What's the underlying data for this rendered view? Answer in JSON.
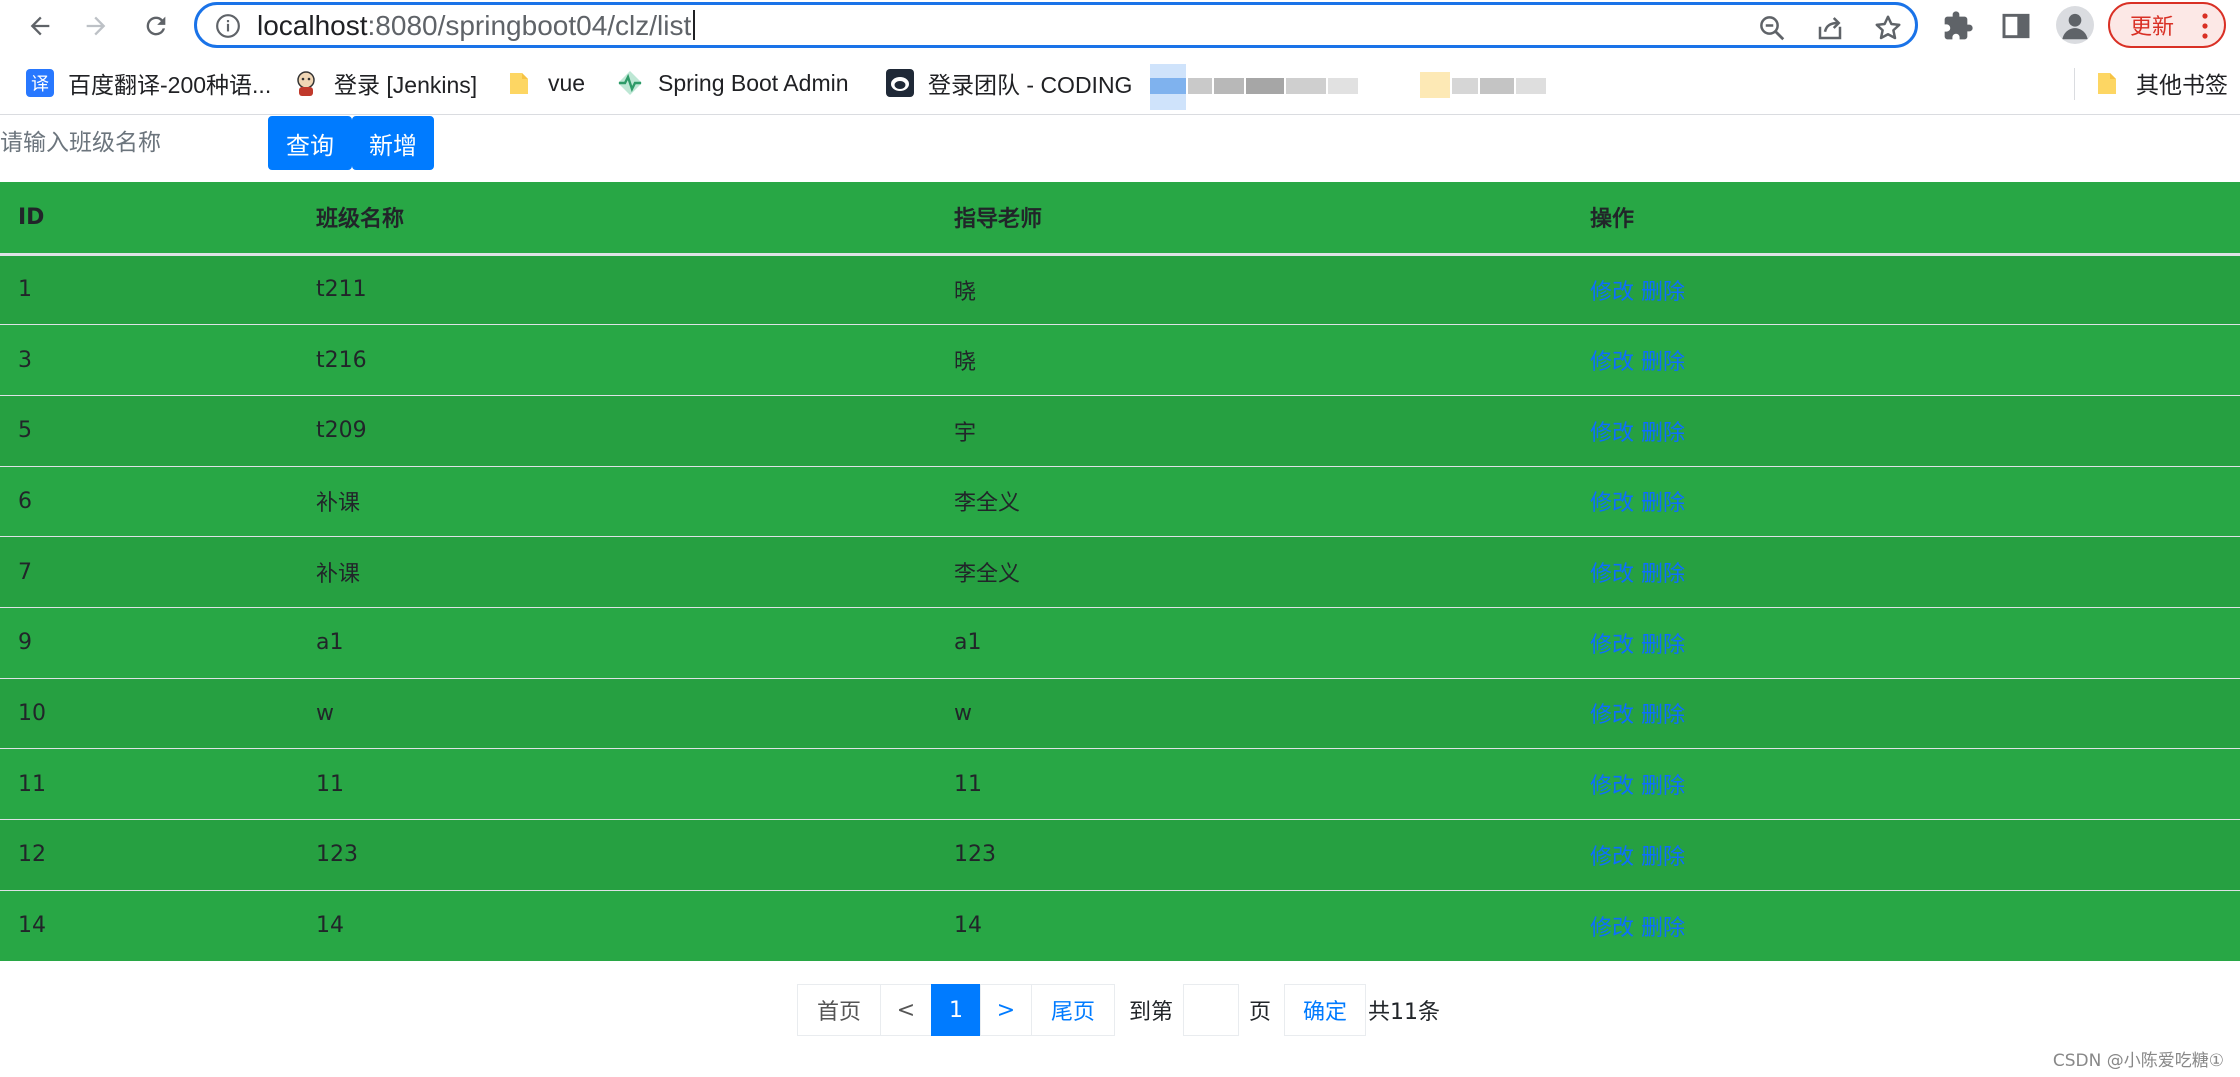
{
  "browser": {
    "url_host": "localhost",
    "url_rest": ":8080/springboot04/clz/list",
    "update_label": "更新"
  },
  "bookmarks": [
    {
      "label": "百度翻译-200种语...",
      "icon": "translate-icon"
    },
    {
      "label": "登录 [Jenkins]",
      "icon": "jenkins-icon"
    },
    {
      "label": "vue",
      "icon": "folder-icon"
    },
    {
      "label": "Spring Boot Admin",
      "icon": "pulse-icon"
    },
    {
      "label": "登录团队 - CODING",
      "icon": "coding-icon"
    }
  ],
  "other_bookmarks": "其他书签",
  "search": {
    "placeholder": "请输入班级名称",
    "query_label": "查询",
    "add_label": "新增"
  },
  "table": {
    "headers": [
      "ID",
      "班级名称",
      "指导老师",
      "操作"
    ],
    "edit_label": "修改",
    "delete_label": "删除",
    "rows": [
      {
        "id": "1",
        "name": "t211",
        "teacher": "晓"
      },
      {
        "id": "3",
        "name": "t216",
        "teacher": "晓"
      },
      {
        "id": "5",
        "name": "t209",
        "teacher": "宇"
      },
      {
        "id": "6",
        "name": "补课",
        "teacher": "李全义"
      },
      {
        "id": "7",
        "name": "补课",
        "teacher": "李全义"
      },
      {
        "id": "9",
        "name": "a1",
        "teacher": "a1"
      },
      {
        "id": "10",
        "name": "w",
        "teacher": "w"
      },
      {
        "id": "11",
        "name": "11",
        "teacher": "11"
      },
      {
        "id": "12",
        "name": "123",
        "teacher": "123"
      },
      {
        "id": "14",
        "name": "14",
        "teacher": "14"
      }
    ]
  },
  "pagination": {
    "first": "首页",
    "prev": "<",
    "current": "1",
    "next": ">",
    "last": "尾页",
    "goto_prefix": "到第",
    "goto_suffix": "页",
    "confirm": "确定",
    "total": "共11条"
  },
  "watermark": "CSDN @小陈爱吃糖①",
  "colors": {
    "accent": "#1a73e8",
    "primary": "#007bff",
    "row_green": "#28a745",
    "link": "#0d6efd"
  }
}
